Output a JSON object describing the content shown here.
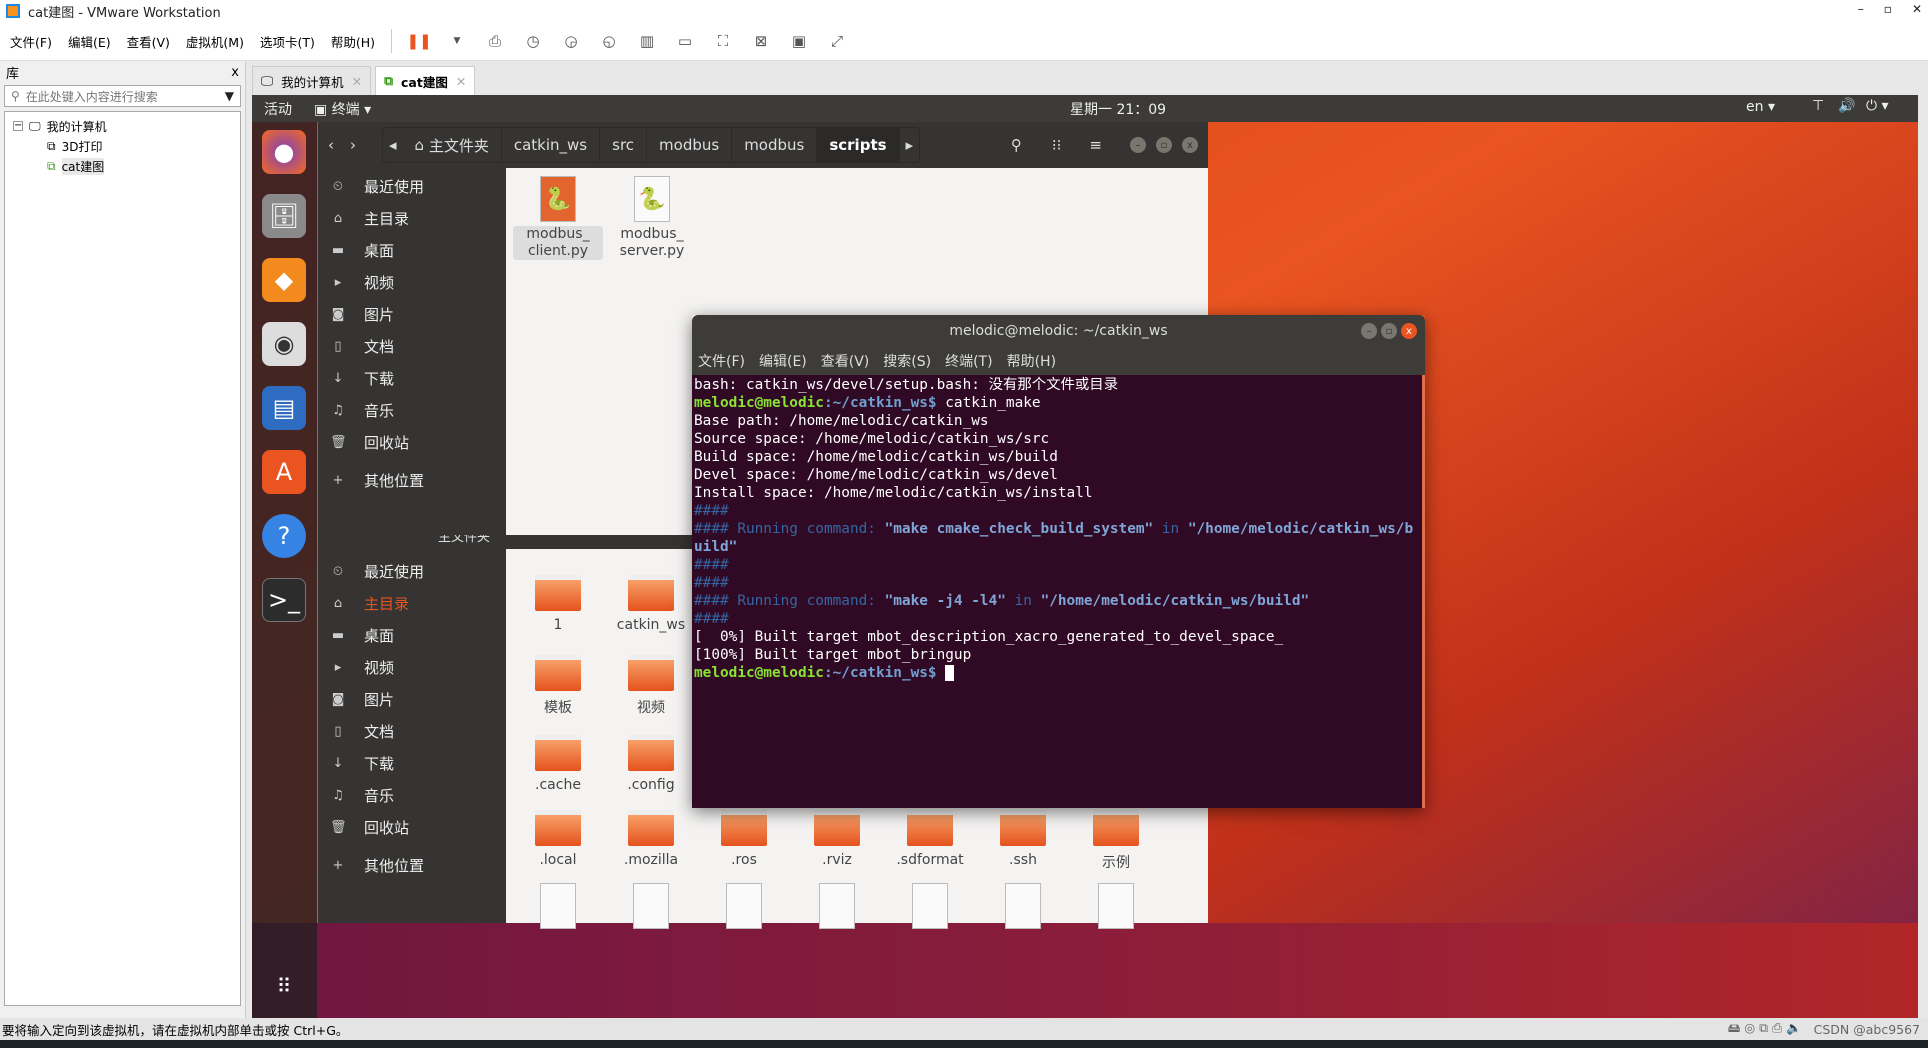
{
  "window": {
    "title": "cat建图 - VMware Workstation",
    "controls": [
      "–",
      "▫",
      "✕"
    ]
  },
  "menu": [
    "文件(F)",
    "编辑(E)",
    "查看(V)",
    "虚拟机(M)",
    "选项卡(T)",
    "帮助(H)"
  ],
  "library": {
    "title": "库",
    "close": "x",
    "search_placeholder": "在此处键入内容进行搜索",
    "tree": [
      {
        "label": "我的计算机",
        "level": 0
      },
      {
        "label": "3D打印",
        "level": 1
      },
      {
        "label": "cat建图",
        "level": 1
      }
    ]
  },
  "vm_tabs": [
    {
      "label": "我的计算机",
      "active": false
    },
    {
      "label": "cat建图",
      "active": true
    }
  ],
  "ubuntu_topbar": {
    "activities": "活动",
    "app": "终端",
    "clock": "星期一 21：09",
    "lang": "en"
  },
  "file_manager_top": {
    "breadcrumb": [
      "主文件夹",
      "catkin_ws",
      "src",
      "modbus",
      "modbus",
      "scripts"
    ],
    "files": [
      {
        "name": "modbus_\nclient.py",
        "icon": "python-file-icon"
      },
      {
        "name": "modbus_\nserver.py",
        "icon": "python-file-icon"
      }
    ]
  },
  "sidebar": [
    "最近使用",
    "主目录",
    "桌面",
    "视频",
    "图片",
    "文档",
    "下载",
    "音乐",
    "回收站",
    "其他位置"
  ],
  "file_manager_bottom": {
    "breadcrumb_partial": "主文件夹",
    "files": [
      [
        "1",
        "catkin_ws"
      ],
      [
        "模板",
        "视频"
      ],
      [
        ".cache",
        ".config"
      ],
      [
        ".local",
        ".mozilla",
        ".ros",
        ".rviz",
        ".sdformat",
        ".ssh",
        "示例"
      ]
    ]
  },
  "terminal": {
    "title": "melodic@melodic: ~/catkin_ws",
    "menu": [
      "文件(F)",
      "编辑(E)",
      "查看(V)",
      "搜索(S)",
      "终端(T)",
      "帮助(H)"
    ],
    "prompt_user": "melodic@melodic",
    "prompt_path": ":~/catkin_ws$",
    "lines": {
      "l1": "bash: catkin_ws/devel/setup.bash: 没有那个文件或目录",
      "cmd": " catkin_make",
      "l3": "Base path: /home/melodic/catkin_ws",
      "l4": "Source space: /home/melodic/catkin_ws/src",
      "l5": "Build space: /home/melodic/catkin_ws/build",
      "l6": "Devel space: /home/melodic/catkin_ws/devel",
      "l7": "Install space: /home/melodic/catkin_ws/install",
      "hash": "####",
      "run_prefix": "#### Running command: ",
      "run1_cmd": "\"make cmake_check_build_system\"",
      "in": " in ",
      "run1_dir": "\"/home/melodic/catkin_ws/build\"",
      "run2_cmd": "\"make -j4 -l4\"",
      "run2_dir": "\"/home/melodic/catkin_ws/build\"",
      "b1": "[  0%] Built target mbot_description_xacro_generated_to_devel_space_",
      "b2": "[100%] Built target mbot_bringup"
    }
  },
  "statusbar": {
    "message": "要将输入定向到该虚拟机，请在虚拟机内部单击或按 Ctrl+G。",
    "watermark": "CSDN @abc9567"
  }
}
